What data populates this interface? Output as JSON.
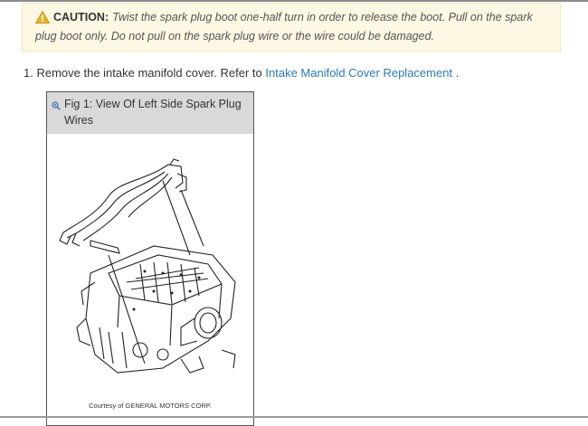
{
  "caution": {
    "label": "CAUTION:",
    "icon": "warning-triangle-icon",
    "message": "Twist the spark plug boot one-half turn in order to release the boot. Pull on the spark plug boot only. Do not pull on the spark plug wire or the wire could be damaged."
  },
  "step": {
    "number": "1.",
    "text": "Remove the intake manifold cover. Refer to",
    "link": "Intake Manifold Cover Replacement",
    "suffix": "."
  },
  "figure": {
    "zoom_icon": "magnify-icon",
    "title": "Fig 1: View Of Left Side Spark Plug Wires",
    "credit": "Courtesy of GENERAL MOTORS CORP."
  },
  "colors": {
    "caution_bg": "#fcf8e3",
    "link": "#2a7ab8",
    "header_bg": "#d9d9d9"
  }
}
